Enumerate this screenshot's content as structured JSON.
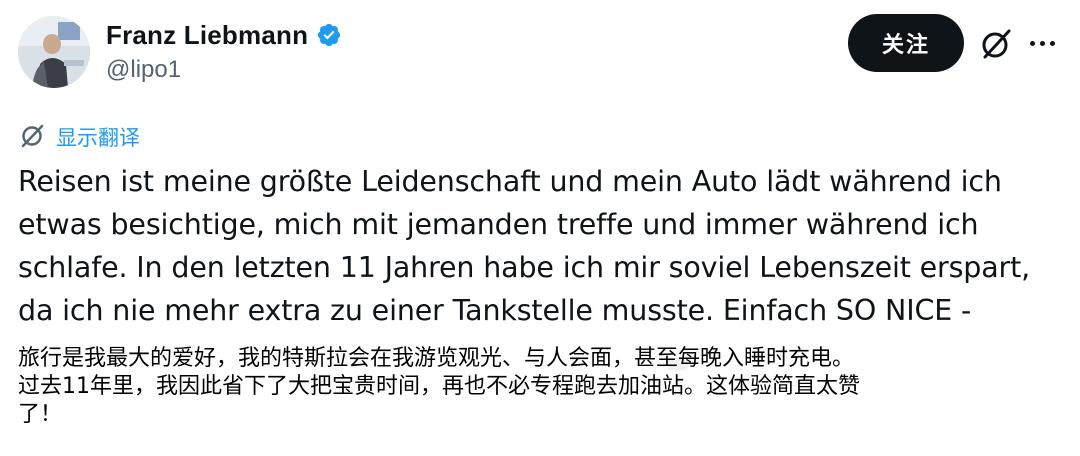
{
  "author": {
    "name": "Franz Liebmann",
    "handle": "@lipo1",
    "verified": true
  },
  "actions": {
    "follow_label": "关注",
    "grok_icon": "grok-slash-circle-icon",
    "more_icon": "more-dots-icon"
  },
  "translate": {
    "label": "显示翻译",
    "icon": "translate-slash-icon"
  },
  "post": {
    "lines": [
      "Reisen ist meine größte Leidenschaft und mein Auto lädt während ich",
      "etwas besichtige, mich mit jemanden treffe und immer während ich",
      "schlafe. In den letzten 11 Jahren habe ich mir soviel Lebenszeit erspart,",
      "da ich nie mehr extra zu einer Tankstelle musste. Einfach SO NICE -"
    ]
  },
  "caption": {
    "lines": [
      "旅行是我最大的爱好，我的特斯拉会在我游览观光、与人会面，甚至每晚入睡时充电。",
      "过去11年里，我因此省下了大把宝贵时间，再也不必专程跑去加油站。这体验简直太赞",
      "了！"
    ]
  },
  "colors": {
    "verified_blue": "#1d9bf0",
    "link_blue": "#1d9bf0",
    "follow_bg": "#0f1419",
    "secondary_text": "#536471"
  }
}
